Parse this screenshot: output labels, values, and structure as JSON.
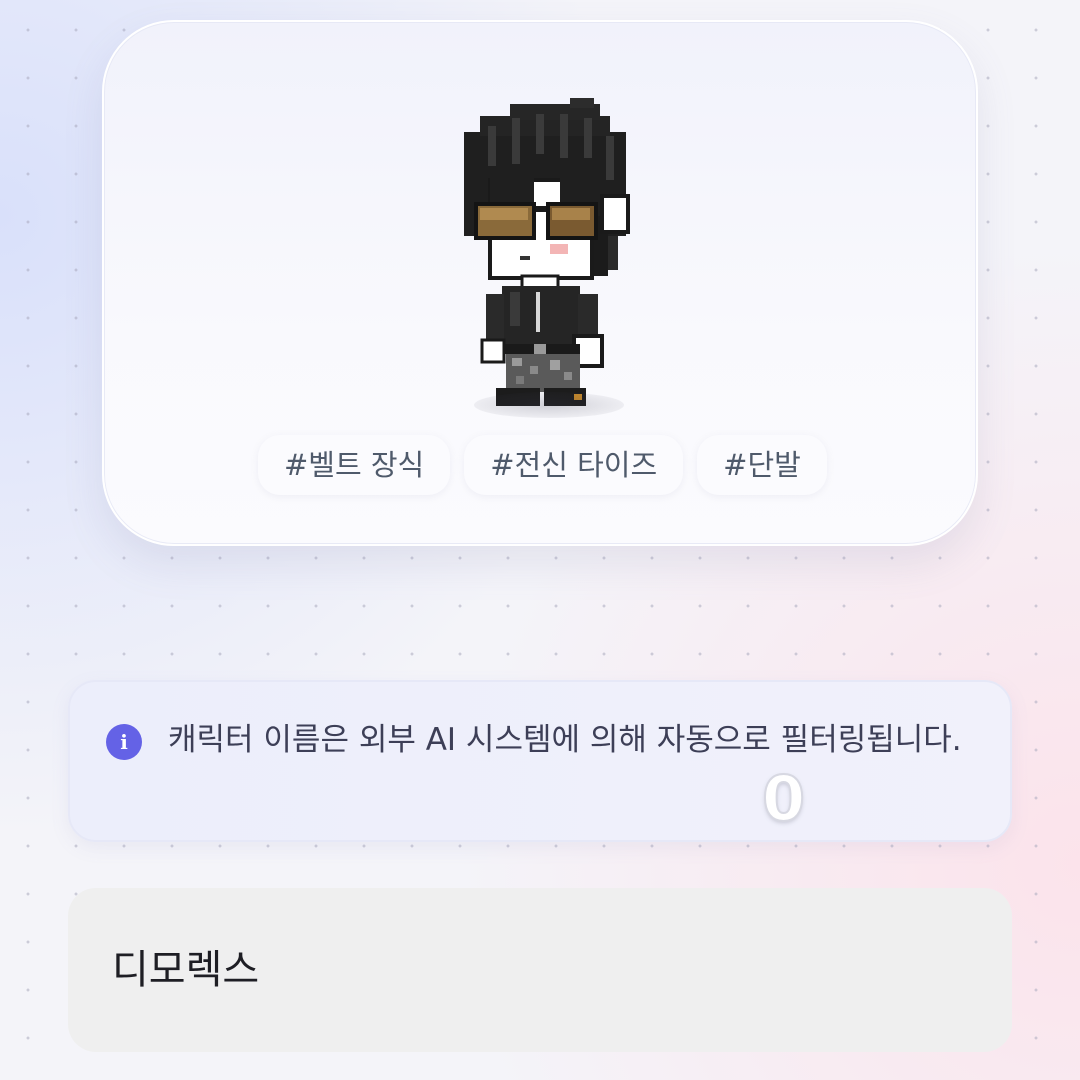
{
  "character": {
    "avatar_icon": "pixel-character-avatar",
    "tags": [
      "#벨트 장식",
      "#전신 타이즈",
      "#단발"
    ]
  },
  "notice": {
    "icon": "info-icon",
    "icon_glyph": "i",
    "text": "캐릭터 이름은 외부 AI 시스템에 의해 자동으로 필터링됩니다."
  },
  "counter": {
    "value": "0"
  },
  "name_field": {
    "value": "디모렉스"
  },
  "colors": {
    "accent": "#6462e6",
    "tag_text": "#4f5a6b",
    "field_background": "#efefef"
  }
}
